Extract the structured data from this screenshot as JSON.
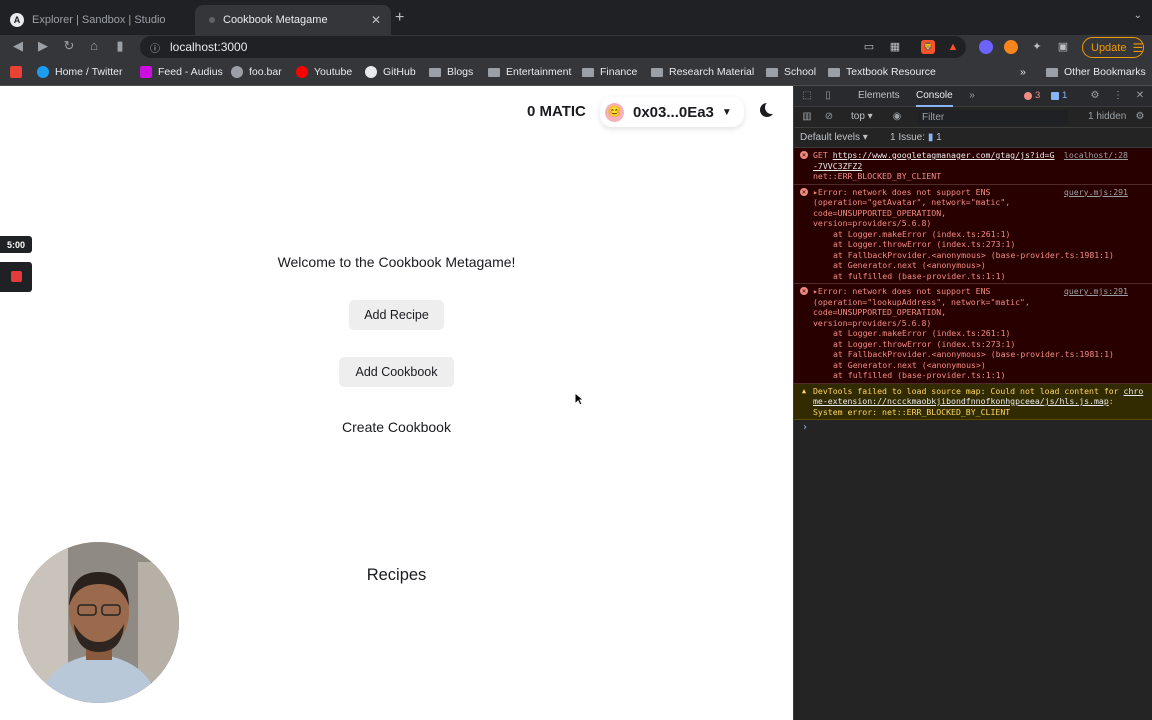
{
  "browser": {
    "tabs": [
      {
        "title": "Explorer | Sandbox | Studio",
        "active": false
      },
      {
        "title": "Cookbook Metagame",
        "active": true
      }
    ],
    "url": "localhost:3000",
    "update_label": "Update",
    "bookmarks": [
      {
        "label": "Home / Twitter",
        "icon": "twitter-icon",
        "color": "#1d9bf0"
      },
      {
        "label": "Feed - Audius",
        "icon": "audius-icon",
        "color": "#cc0fe0"
      },
      {
        "label": "foo.bar",
        "icon": "globe-icon",
        "color": "#9aa0a6"
      },
      {
        "label": "Youtube",
        "icon": "youtube-icon",
        "color": "#ff0000"
      },
      {
        "label": "GitHub",
        "icon": "github-icon",
        "color": "#e8eaed"
      },
      {
        "label": "Blogs",
        "icon": "folder-icon"
      },
      {
        "label": "Entertainment",
        "icon": "folder-icon"
      },
      {
        "label": "Finance",
        "icon": "folder-icon"
      },
      {
        "label": "Research Material",
        "icon": "folder-icon"
      },
      {
        "label": "School",
        "icon": "folder-icon"
      },
      {
        "label": "Textbook Resource",
        "icon": "folder-icon"
      },
      {
        "label": "Other Bookmarks",
        "icon": "folder-icon"
      }
    ]
  },
  "page": {
    "balance": "0 MATIC",
    "account_address": "0x03...0Ea3",
    "account_avatar": "😊",
    "welcome": "Welcome to the Cookbook Metagame!",
    "add_recipe_label": "Add Recipe",
    "add_cookbook_label": "Add Cookbook",
    "create_cookbook_title": "Create Cookbook",
    "recipes_title": "Recipes",
    "recording_timer": "5:00"
  },
  "devtools": {
    "tabs": [
      "Elements",
      "Console"
    ],
    "active_tab": "Console",
    "error_count": "3",
    "message_count": "1",
    "context": "top",
    "filter_placeholder": "Filter",
    "hidden_label": "1 hidden",
    "levels_label": "Default levels",
    "issues_label": "1 Issue:",
    "issues_count": "1",
    "messages": [
      {
        "type": "error",
        "line1": "GET ",
        "url": "https://www.googletagmanager.com/gtag/js?id=G-7VVC3ZFZ2",
        "line2": "net::ERR_BLOCKED_BY_CLIENT",
        "source": "localhost/:28"
      },
      {
        "type": "error",
        "text": "▸Error: network does not support ENS (operation=\"getAvatar\", network=\"matic\", code=UNSUPPORTED_OPERATION, version=providers/5.6.8)",
        "stack1": "at Logger.makeError (index.ts:261:1)",
        "stack2": "at Logger.throwError (index.ts:273:1)",
        "stack3": "at FallbackProvider.<anonymous> (base-provider.ts:1981:1)",
        "stack4": "at Generator.next (<anonymous>)",
        "stack5": "at fulfilled (base-provider.ts:1:1)",
        "source": "query.mjs:291"
      },
      {
        "type": "error",
        "text": "▸Error: network does not support ENS (operation=\"lookupAddress\", network=\"matic\", code=UNSUPPORTED_OPERATION, version=providers/5.6.8)",
        "stack1": "at Logger.makeError (index.ts:261:1)",
        "stack2": "at Logger.throwError (index.ts:273:1)",
        "stack3": "at FallbackProvider.<anonymous> (base-provider.ts:1981:1)",
        "stack4": "at Generator.next (<anonymous>)",
        "stack5": "at fulfilled (base-provider.ts:1:1)",
        "source": "query.mjs:291"
      },
      {
        "type": "warning",
        "text": "DevTools failed to load source map: Could not load content for ",
        "url": "chrome-extension://nccckmaobkjibondfnnofkonhgpceea/js/hls.js.map",
        "tail": ": System error: net::ERR_BLOCKED_BY_CLIENT"
      }
    ]
  }
}
